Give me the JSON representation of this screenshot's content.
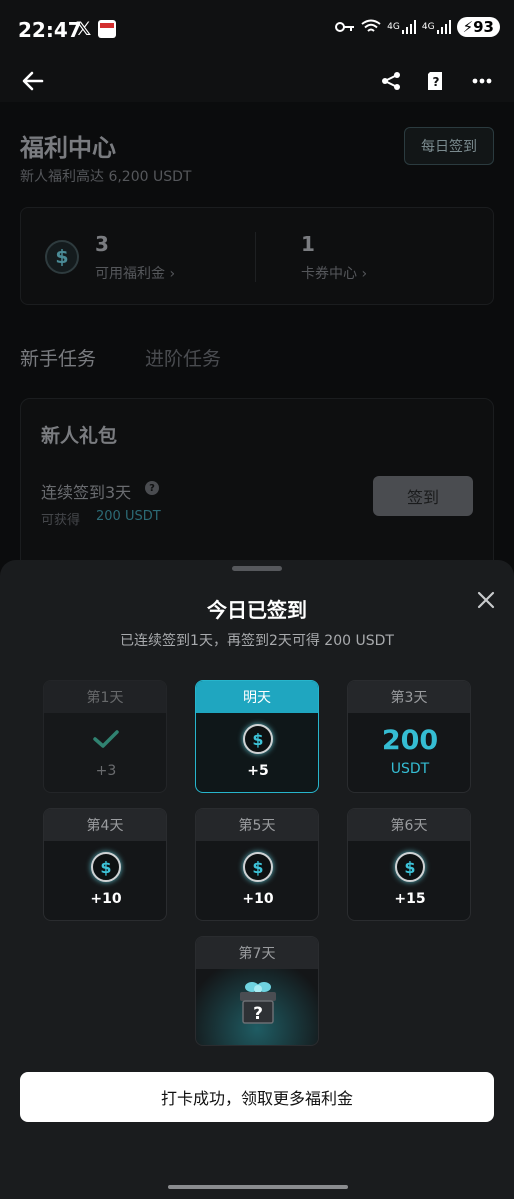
{
  "status_bar": {
    "time": "22:47",
    "x_glyph": "𝕏",
    "network_1": "4G",
    "network_2": "4G",
    "battery": "93"
  },
  "page": {
    "title": "福利中心",
    "subtitle": "新人福利高达 6,200 USDT",
    "daily_button": "每日签到",
    "stats": [
      {
        "value": "3",
        "label": "可用福利金 ›"
      },
      {
        "value": "1",
        "label": "卡券中心 ›"
      }
    ],
    "tabs": [
      "新手任务",
      "进阶任务"
    ],
    "task_card": {
      "title": "新人礼包",
      "task": "连续签到3天",
      "earn_label": "可获得",
      "reward": "200 USDT",
      "button": "签到"
    }
  },
  "sheet": {
    "title": "今日已签到",
    "subtitle": "已连续签到1天，再签到2天可得 200 USDT",
    "days": [
      {
        "label": "第1天",
        "amount": "+3"
      },
      {
        "label": "明天",
        "amount": "+5"
      },
      {
        "label": "第3天",
        "amount": "200",
        "unit": "USDT"
      },
      {
        "label": "第4天",
        "amount": "+10"
      },
      {
        "label": "第5天",
        "amount": "+10"
      },
      {
        "label": "第6天",
        "amount": "+15"
      },
      {
        "label": "第7天"
      }
    ],
    "cta": "打卡成功，领取更多福利金"
  },
  "colors": {
    "accent": "#1fa6c0",
    "sheet_bg": "#1a1c1e",
    "check": "#3fc7a8"
  }
}
